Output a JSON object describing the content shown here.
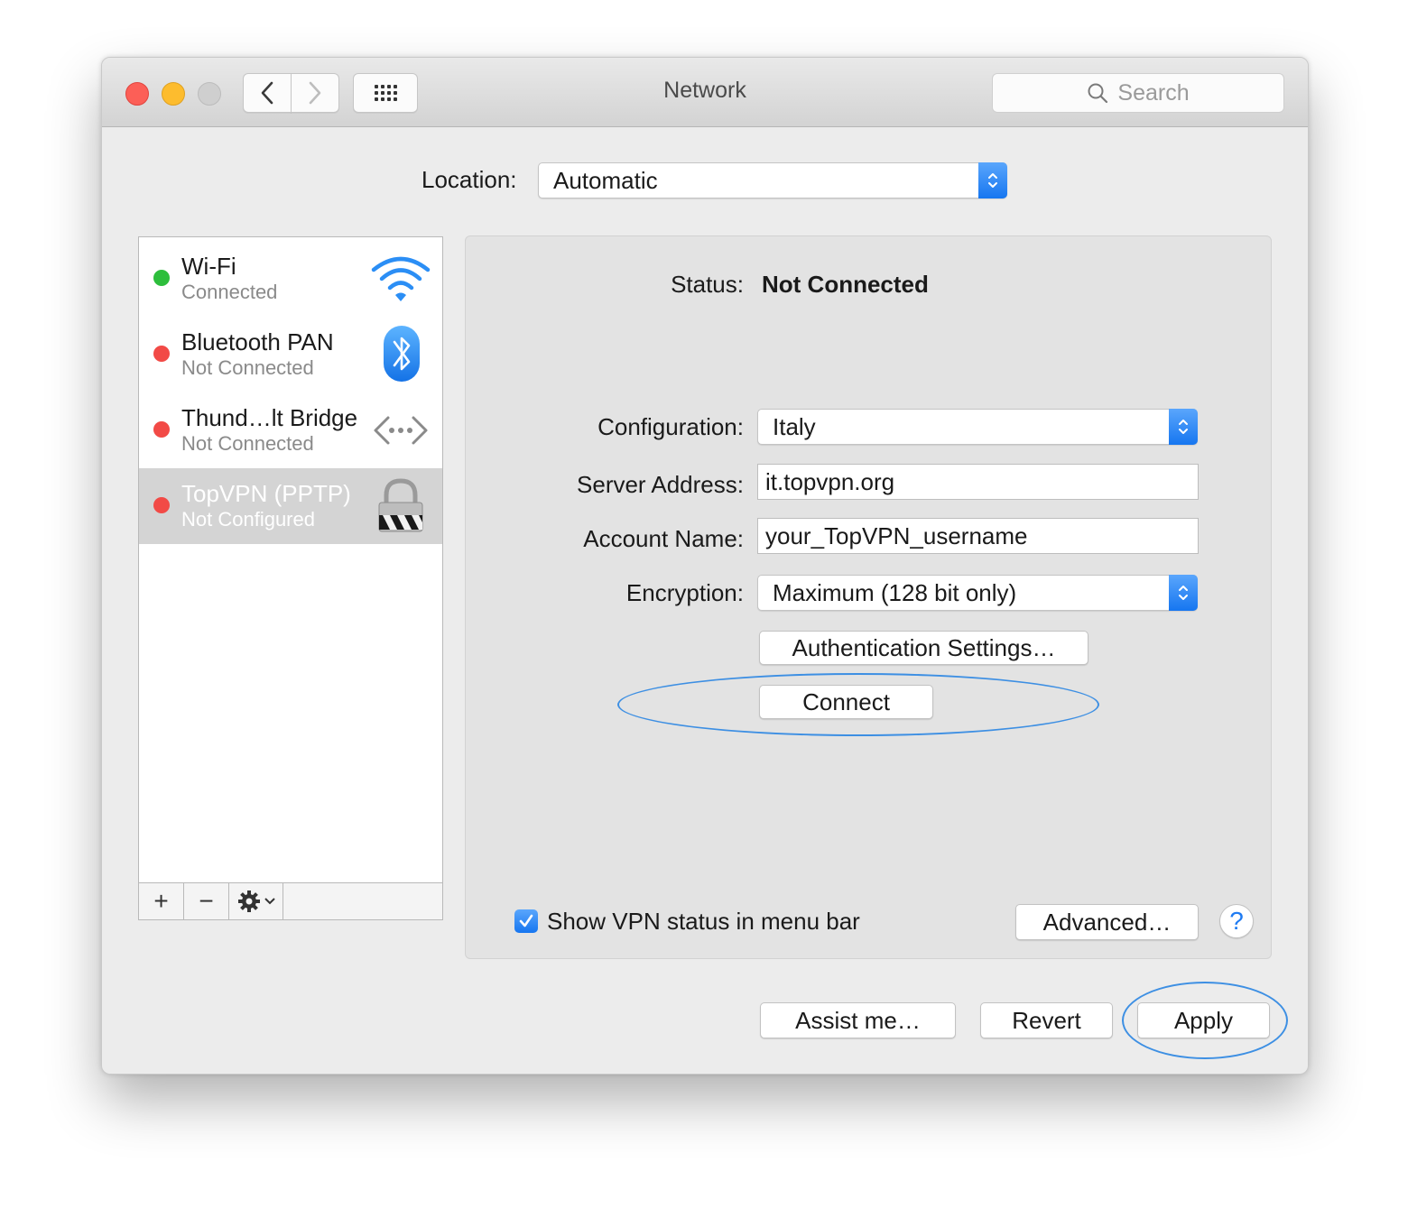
{
  "window": {
    "title": "Network",
    "search_placeholder": "Search",
    "icons": {
      "back": "chevron-left-icon",
      "forward": "chevron-right-icon",
      "show_all": "grid-icon",
      "search": "magnifier-icon"
    }
  },
  "location": {
    "label": "Location:",
    "value": "Automatic"
  },
  "services": [
    {
      "name": "Wi-Fi",
      "status": "Connected",
      "dot_color": "#2dbe3c",
      "icon": "wifi-icon"
    },
    {
      "name": "Bluetooth PAN",
      "status": "Not Connected",
      "dot_color": "#f24a46",
      "icon": "bluetooth-icon"
    },
    {
      "name": "Thund…lt Bridge",
      "status": "Not Connected",
      "dot_color": "#f24a46",
      "icon": "thunderbolt-bridge-icon"
    },
    {
      "name": "TopVPN (PPTP)",
      "status": "Not Configured",
      "dot_color": "#f24a46",
      "icon": "vpn-lock-icon",
      "selected": true
    }
  ],
  "sidebar_footer": {
    "add": "+",
    "remove": "−",
    "action_icon": "gear-icon"
  },
  "detail": {
    "status_label": "Status:",
    "status_value": "Not Connected",
    "configuration": {
      "label": "Configuration:",
      "value": "Italy"
    },
    "server_address": {
      "label": "Server Address:",
      "value": "it.topvpn.org"
    },
    "account_name": {
      "label": "Account Name:",
      "value": "your_TopVPN_username"
    },
    "encryption": {
      "label": "Encryption:",
      "value": "Maximum (128 bit only)"
    },
    "auth_button": "Authentication Settings…",
    "connect_button": "Connect",
    "show_vpn_status": {
      "label": "Show VPN status in menu bar",
      "checked": true
    },
    "advanced_button": "Advanced…",
    "help": "?"
  },
  "footer": {
    "assist": "Assist me…",
    "revert": "Revert",
    "apply": "Apply"
  },
  "colors": {
    "accent": "#1676f0",
    "highlight_ring": "#3d8fe3"
  }
}
